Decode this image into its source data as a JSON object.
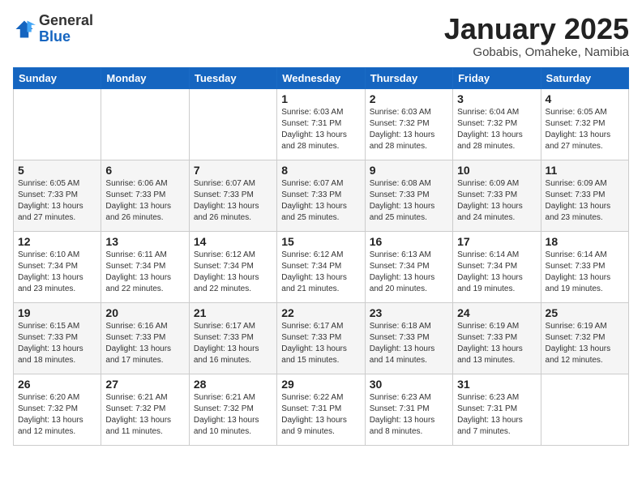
{
  "header": {
    "logo_general": "General",
    "logo_blue": "Blue",
    "title": "January 2025",
    "subtitle": "Gobabis, Omaheke, Namibia"
  },
  "weekdays": [
    "Sunday",
    "Monday",
    "Tuesday",
    "Wednesday",
    "Thursday",
    "Friday",
    "Saturday"
  ],
  "weeks": [
    [
      {
        "day": "",
        "info": ""
      },
      {
        "day": "",
        "info": ""
      },
      {
        "day": "",
        "info": ""
      },
      {
        "day": "1",
        "info": "Sunrise: 6:03 AM\nSunset: 7:31 PM\nDaylight: 13 hours\nand 28 minutes."
      },
      {
        "day": "2",
        "info": "Sunrise: 6:03 AM\nSunset: 7:32 PM\nDaylight: 13 hours\nand 28 minutes."
      },
      {
        "day": "3",
        "info": "Sunrise: 6:04 AM\nSunset: 7:32 PM\nDaylight: 13 hours\nand 28 minutes."
      },
      {
        "day": "4",
        "info": "Sunrise: 6:05 AM\nSunset: 7:32 PM\nDaylight: 13 hours\nand 27 minutes."
      }
    ],
    [
      {
        "day": "5",
        "info": "Sunrise: 6:05 AM\nSunset: 7:33 PM\nDaylight: 13 hours\nand 27 minutes."
      },
      {
        "day": "6",
        "info": "Sunrise: 6:06 AM\nSunset: 7:33 PM\nDaylight: 13 hours\nand 26 minutes."
      },
      {
        "day": "7",
        "info": "Sunrise: 6:07 AM\nSunset: 7:33 PM\nDaylight: 13 hours\nand 26 minutes."
      },
      {
        "day": "8",
        "info": "Sunrise: 6:07 AM\nSunset: 7:33 PM\nDaylight: 13 hours\nand 25 minutes."
      },
      {
        "day": "9",
        "info": "Sunrise: 6:08 AM\nSunset: 7:33 PM\nDaylight: 13 hours\nand 25 minutes."
      },
      {
        "day": "10",
        "info": "Sunrise: 6:09 AM\nSunset: 7:33 PM\nDaylight: 13 hours\nand 24 minutes."
      },
      {
        "day": "11",
        "info": "Sunrise: 6:09 AM\nSunset: 7:33 PM\nDaylight: 13 hours\nand 23 minutes."
      }
    ],
    [
      {
        "day": "12",
        "info": "Sunrise: 6:10 AM\nSunset: 7:34 PM\nDaylight: 13 hours\nand 23 minutes."
      },
      {
        "day": "13",
        "info": "Sunrise: 6:11 AM\nSunset: 7:34 PM\nDaylight: 13 hours\nand 22 minutes."
      },
      {
        "day": "14",
        "info": "Sunrise: 6:12 AM\nSunset: 7:34 PM\nDaylight: 13 hours\nand 22 minutes."
      },
      {
        "day": "15",
        "info": "Sunrise: 6:12 AM\nSunset: 7:34 PM\nDaylight: 13 hours\nand 21 minutes."
      },
      {
        "day": "16",
        "info": "Sunrise: 6:13 AM\nSunset: 7:34 PM\nDaylight: 13 hours\nand 20 minutes."
      },
      {
        "day": "17",
        "info": "Sunrise: 6:14 AM\nSunset: 7:34 PM\nDaylight: 13 hours\nand 19 minutes."
      },
      {
        "day": "18",
        "info": "Sunrise: 6:14 AM\nSunset: 7:33 PM\nDaylight: 13 hours\nand 19 minutes."
      }
    ],
    [
      {
        "day": "19",
        "info": "Sunrise: 6:15 AM\nSunset: 7:33 PM\nDaylight: 13 hours\nand 18 minutes."
      },
      {
        "day": "20",
        "info": "Sunrise: 6:16 AM\nSunset: 7:33 PM\nDaylight: 13 hours\nand 17 minutes."
      },
      {
        "day": "21",
        "info": "Sunrise: 6:17 AM\nSunset: 7:33 PM\nDaylight: 13 hours\nand 16 minutes."
      },
      {
        "day": "22",
        "info": "Sunrise: 6:17 AM\nSunset: 7:33 PM\nDaylight: 13 hours\nand 15 minutes."
      },
      {
        "day": "23",
        "info": "Sunrise: 6:18 AM\nSunset: 7:33 PM\nDaylight: 13 hours\nand 14 minutes."
      },
      {
        "day": "24",
        "info": "Sunrise: 6:19 AM\nSunset: 7:33 PM\nDaylight: 13 hours\nand 13 minutes."
      },
      {
        "day": "25",
        "info": "Sunrise: 6:19 AM\nSunset: 7:32 PM\nDaylight: 13 hours\nand 12 minutes."
      }
    ],
    [
      {
        "day": "26",
        "info": "Sunrise: 6:20 AM\nSunset: 7:32 PM\nDaylight: 13 hours\nand 12 minutes."
      },
      {
        "day": "27",
        "info": "Sunrise: 6:21 AM\nSunset: 7:32 PM\nDaylight: 13 hours\nand 11 minutes."
      },
      {
        "day": "28",
        "info": "Sunrise: 6:21 AM\nSunset: 7:32 PM\nDaylight: 13 hours\nand 10 minutes."
      },
      {
        "day": "29",
        "info": "Sunrise: 6:22 AM\nSunset: 7:31 PM\nDaylight: 13 hours\nand 9 minutes."
      },
      {
        "day": "30",
        "info": "Sunrise: 6:23 AM\nSunset: 7:31 PM\nDaylight: 13 hours\nand 8 minutes."
      },
      {
        "day": "31",
        "info": "Sunrise: 6:23 AM\nSunset: 7:31 PM\nDaylight: 13 hours\nand 7 minutes."
      },
      {
        "day": "",
        "info": ""
      }
    ]
  ]
}
